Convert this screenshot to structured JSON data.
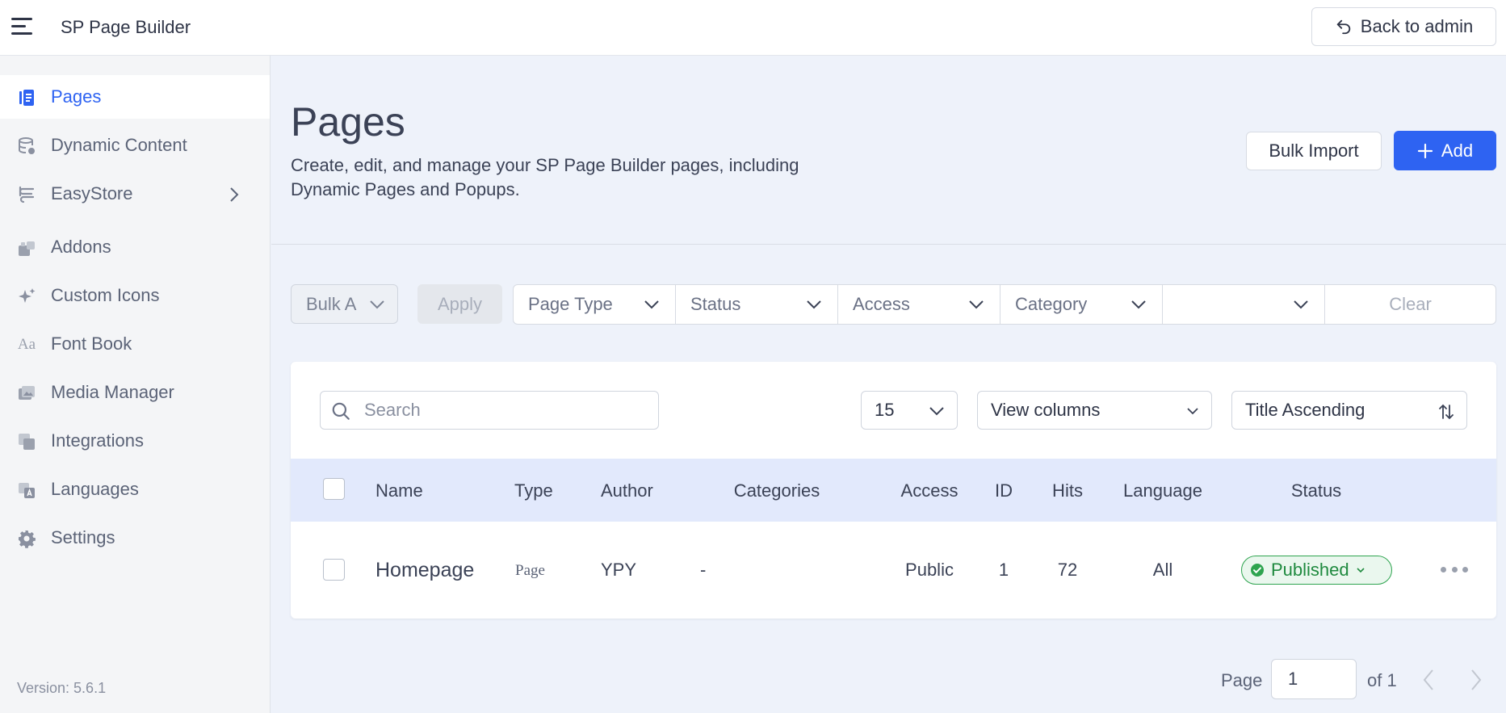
{
  "topbar": {
    "app_title": "SP Page Builder",
    "back_label": "Back to admin"
  },
  "sidebar": {
    "items": [
      {
        "label": "Pages",
        "icon": "pages-icon",
        "active": true
      },
      {
        "label": "Dynamic Content",
        "icon": "database-icon"
      },
      {
        "label": "EasyStore",
        "icon": "cart-icon",
        "has_submenu": true
      },
      {
        "label": "Addons",
        "icon": "addons-icon"
      },
      {
        "label": "Custom Icons",
        "icon": "sparkle-icon"
      },
      {
        "label": "Font Book",
        "icon": "font-icon",
        "glyph": "Aa"
      },
      {
        "label": "Media Manager",
        "icon": "media-icon"
      },
      {
        "label": "Integrations",
        "icon": "integrations-icon"
      },
      {
        "label": "Languages",
        "icon": "languages-icon"
      },
      {
        "label": "Settings",
        "icon": "gear-icon"
      }
    ],
    "version": "Version: 5.6.1"
  },
  "header": {
    "title": "Pages",
    "description": "Create, edit, and manage your SP Page Builder pages, including Dynamic Pages and Popups.",
    "bulk_import_label": "Bulk Import",
    "add_label": "Add"
  },
  "filters": {
    "bulk_action": "Bulk A",
    "apply_label": "Apply",
    "page_type": "Page Type",
    "status": "Status",
    "access": "Access",
    "category": "Category",
    "language": "",
    "clear_label": "Clear"
  },
  "table_controls": {
    "search_placeholder": "Search",
    "per_page": "15",
    "view_columns": "View columns",
    "sort": "Title Ascending"
  },
  "table": {
    "columns": [
      "Name",
      "Type",
      "Author",
      "Categories",
      "Access",
      "ID",
      "Hits",
      "Language",
      "Status"
    ],
    "rows": [
      {
        "name": "Homepage",
        "type": "Page",
        "author": "YPY",
        "categories": "-",
        "access": "Public",
        "id": "1",
        "hits": "72",
        "language": "All",
        "status": "Published"
      }
    ]
  },
  "pagination": {
    "page_label": "Page",
    "current_page": "1",
    "of_label": "of 1"
  },
  "colors": {
    "accent": "#2e63f2",
    "published": "#2ea44f",
    "table_header_bg": "#e2e9fc",
    "main_bg": "#eef2fa"
  }
}
